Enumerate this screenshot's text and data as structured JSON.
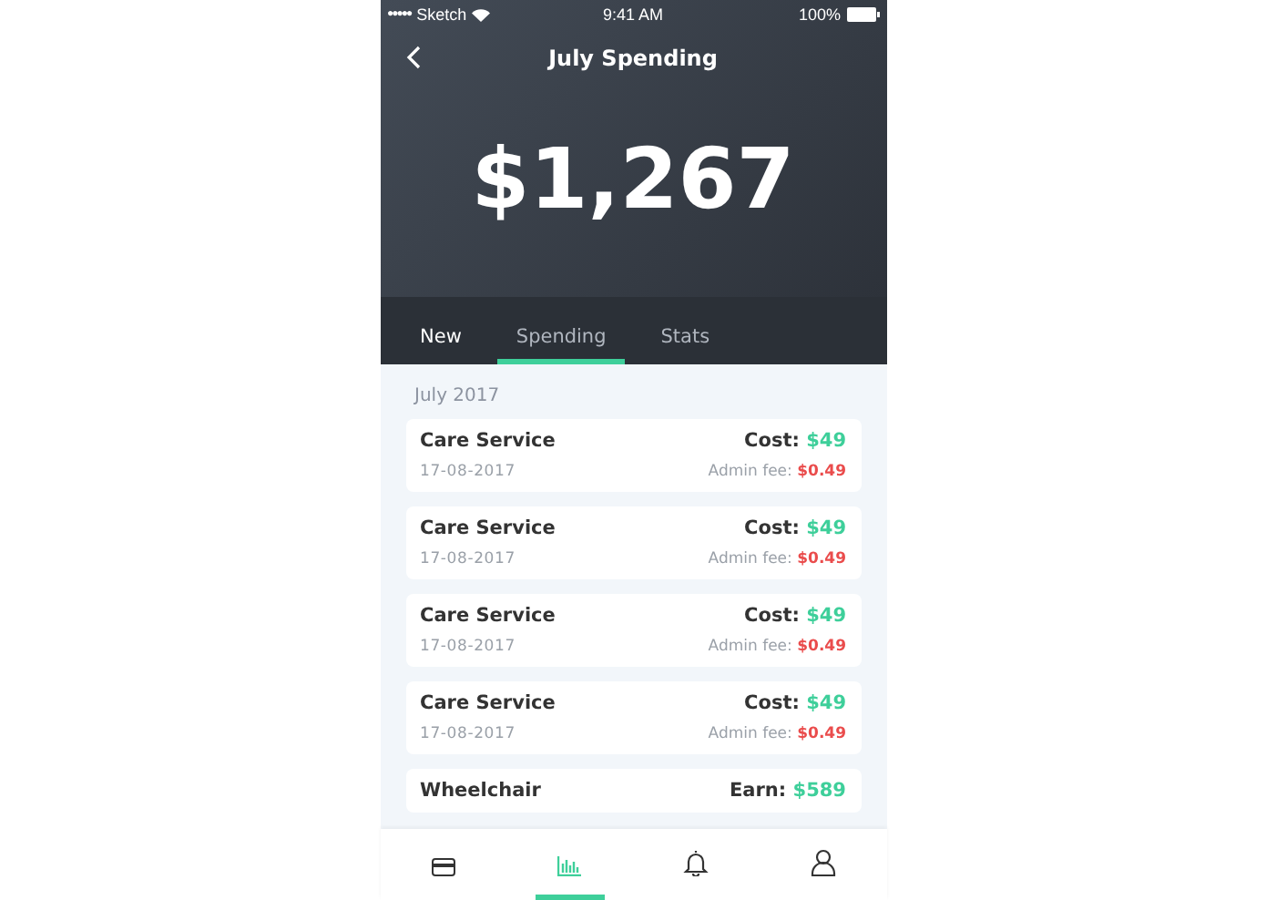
{
  "status_bar": {
    "signal": "●●●●●",
    "carrier": "Sketch",
    "time": "9:41 AM",
    "battery": "100%"
  },
  "header": {
    "title": "July Spending",
    "amount": "$1,267"
  },
  "tabs": [
    {
      "label": "New",
      "selected": false
    },
    {
      "label": "Spending",
      "selected": true
    },
    {
      "label": "Stats",
      "selected": false
    }
  ],
  "section": "July 2017",
  "transactions": [
    {
      "name": "Care Service",
      "date": "17-08-2017",
      "primary": {
        "label": "Cost:",
        "value": "$49"
      },
      "secondary": {
        "label": "Admin fee:",
        "value": "$0.49"
      }
    },
    {
      "name": "Care Service",
      "date": "17-08-2017",
      "primary": {
        "label": "Cost:",
        "value": "$49"
      },
      "secondary": {
        "label": "Admin fee:",
        "value": "$0.49"
      }
    },
    {
      "name": "Care Service",
      "date": "17-08-2017",
      "primary": {
        "label": "Cost:",
        "value": "$49"
      },
      "secondary": {
        "label": "Admin fee:",
        "value": "$0.49"
      }
    },
    {
      "name": "Care Service",
      "date": "17-08-2017",
      "primary": {
        "label": "Cost:",
        "value": "$49"
      },
      "secondary": {
        "label": "Admin fee:",
        "value": "$0.49"
      }
    },
    {
      "name": "Wheelchair",
      "primary": {
        "label": "Earn:",
        "value": "$589"
      }
    }
  ],
  "bottom_nav": [
    {
      "kind": "card",
      "selected": false
    },
    {
      "kind": "chart",
      "selected": true
    },
    {
      "kind": "bell",
      "selected": false
    },
    {
      "kind": "person",
      "selected": false
    }
  ]
}
